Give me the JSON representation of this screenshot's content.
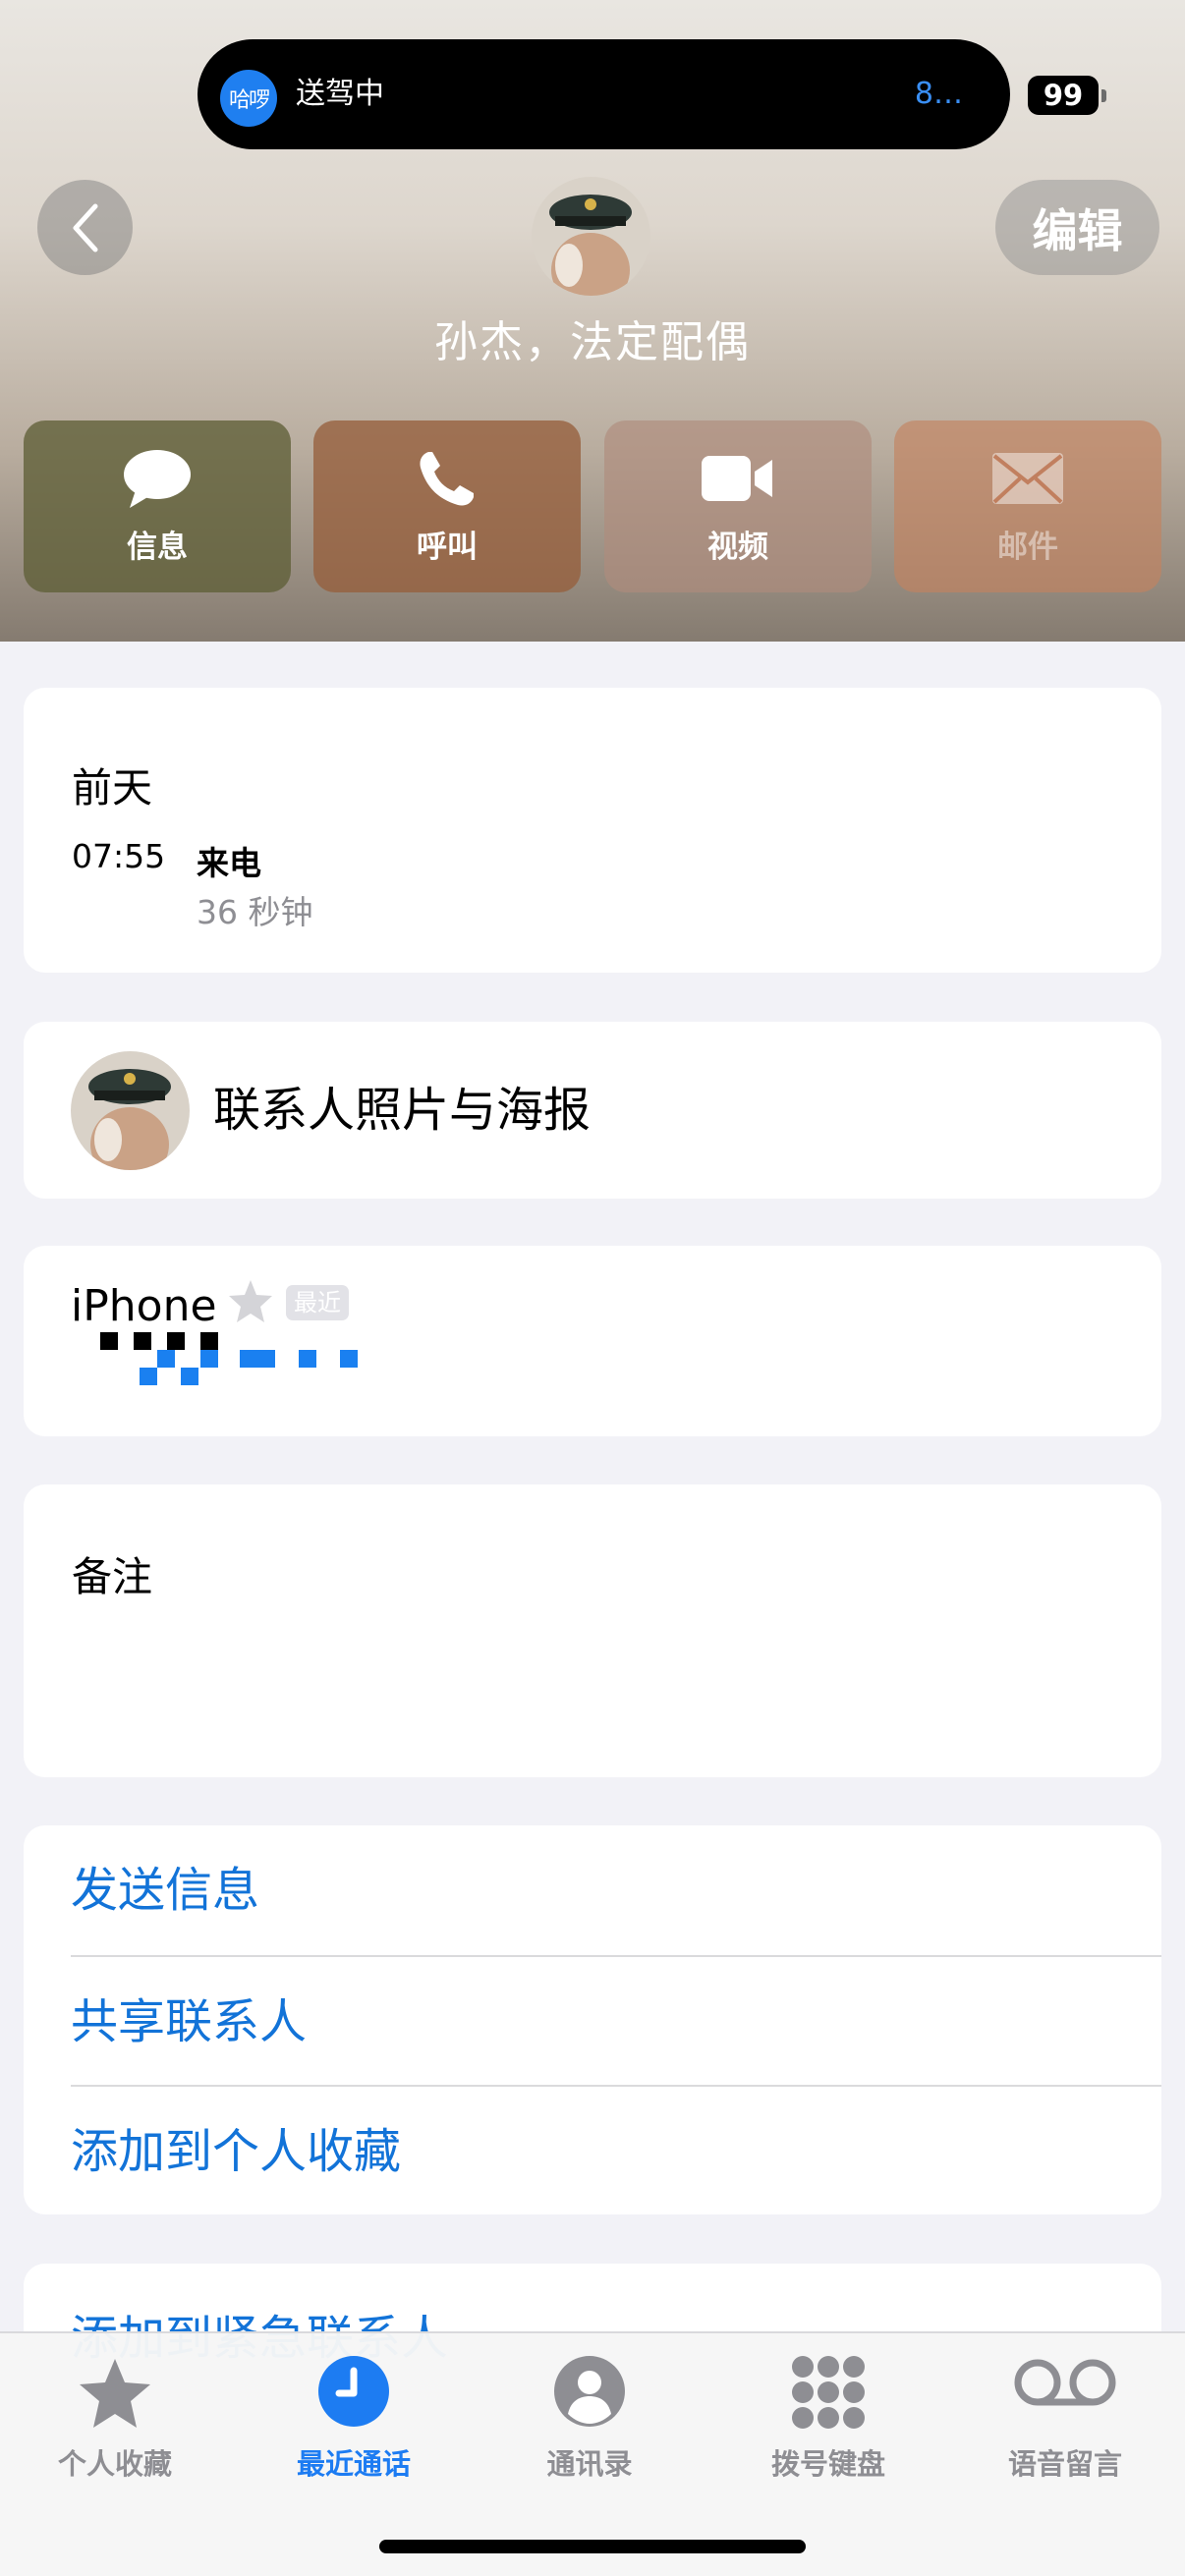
{
  "status_bar": {
    "island_app": "哈啰",
    "island_text": "送驾中",
    "island_eta": "8…",
    "battery": "99"
  },
  "header": {
    "edit_label": "编辑",
    "contact_name": "孙杰，法定配偶",
    "actions": [
      {
        "label": "信息",
        "icon": "message-bubble-icon"
      },
      {
        "label": "呼叫",
        "icon": "phone-icon"
      },
      {
        "label": "视频",
        "icon": "video-camera-icon"
      },
      {
        "label": "邮件",
        "icon": "envelope-icon",
        "disabled": true
      }
    ]
  },
  "recent_call": {
    "day": "前天",
    "time": "07:55",
    "type": "来电",
    "duration": "36 秒钟"
  },
  "poster": {
    "label": "联系人照片与海报"
  },
  "phone": {
    "label": "iPhone",
    "badge": "最近"
  },
  "notes": {
    "label": "备注"
  },
  "links": {
    "send_message": "发送信息",
    "share_contact": "共享联系人",
    "add_favorite": "添加到个人收藏",
    "add_emergency": "添加到紧急联系人"
  },
  "tab_bar": {
    "favorites": "个人收藏",
    "recents": "最近通话",
    "contacts": "通讯录",
    "keypad": "拨号键盘",
    "voicemail": "语音留言",
    "active": "recents",
    "active_color": "#1d7cf2",
    "inactive_color": "#8e8e93"
  },
  "colors": {
    "link": "#1273d8",
    "page_background": "#f2f2f7"
  }
}
